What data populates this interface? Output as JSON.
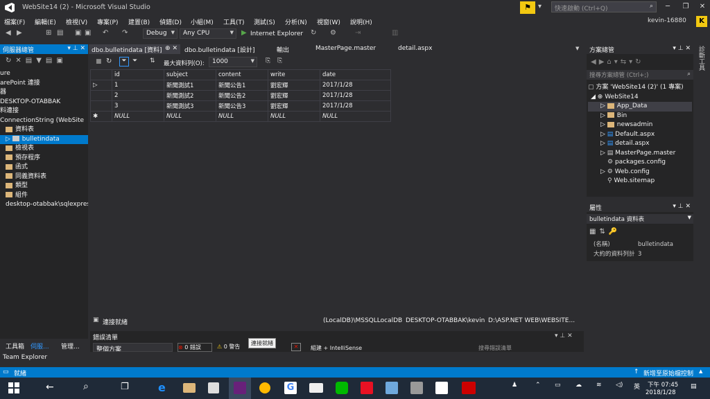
{
  "window": {
    "title": "WebSite14 (2) - Microsoft Visual Studio",
    "quick_launch": "快速啟動 (Ctrl+Q)",
    "user": "kevin-16880",
    "user_badge": "K"
  },
  "menu": [
    "檔案(F)",
    "編輯(E)",
    "檢視(V)",
    "專案(P)",
    "建置(B)",
    "偵錯(D)",
    "小組(M)",
    "工具(T)",
    "測試(S)",
    "分析(N)",
    "視窗(W)",
    "說明(H)"
  ],
  "toolbar": {
    "config": "Debug",
    "platform": "Any CPU",
    "run": "Internet Explorer"
  },
  "server_explorer": {
    "title": "伺服器總管",
    "items": [
      "ure",
      "arePoint 連接",
      "器",
      "DESKTOP-OTABBAK",
      "料連接",
      "ConnectionString (WebSite",
      "資料表",
      "bulletindata",
      "檢視表",
      "預存程序",
      "函式",
      "同義資料表",
      "類型",
      "組件",
      "desktop-otabbak\\sqlexpres"
    ],
    "bottom_tabs": [
      "工具箱",
      "伺服...",
      "管理..."
    ],
    "team": "Team Explorer"
  },
  "tabs": [
    "dbo.bulletindata [資料]",
    "dbo.bulletindata [設計]",
    "輸出",
    "MasterPage.master",
    "detail.aspx"
  ],
  "grid_toolbar": {
    "max_rows_label": "最大資料列(O):",
    "max_rows": "1000"
  },
  "grid": {
    "columns": [
      "id",
      "subject",
      "content",
      "write",
      "date"
    ],
    "rows": [
      [
        "1",
        "新聞測試1",
        "新聞公告1",
        "劉宏輝",
        "2017/1/28"
      ],
      [
        "2",
        "新聞測試2",
        "新聞公告2",
        "劉宏輝",
        "2017/1/28"
      ],
      [
        "3",
        "新聞測試3",
        "新聞公告3",
        "劉宏輝",
        "2017/1/28"
      ],
      [
        "NULL",
        "NULL",
        "NULL",
        "NULL",
        "NULL"
      ]
    ]
  },
  "conn_status": {
    "text": "連接就緒",
    "db": "(LocalDB)\\MSSQLLocalDB",
    "server": "DESKTOP-OTABBAK\\kevin",
    "path": "D:\\ASP.NET WEB\\WEBSITE..."
  },
  "error_list": {
    "title": "錯誤清單",
    "scope": "整個方案",
    "errors": "0 錯誤",
    "warnings": "0 警告",
    "tooltip": "連接就緒",
    "build": "組建 + IntelliSense",
    "search": "搜尋錯誤清單"
  },
  "solution": {
    "title": "方案總管",
    "search": "搜尋方案總管 (Ctrl+;)",
    "root": "方案 'WebSite14 (2)' (1 專案)",
    "project": "WebSite14",
    "items": [
      "App_Data",
      "Bin",
      "newsadmin",
      "Default.aspx",
      "detail.aspx",
      "MasterPage.master",
      "packages.config",
      "Web.config",
      "Web.sitemap"
    ]
  },
  "properties": {
    "title": "屬性",
    "object": "bulletindata  資料表",
    "rows": [
      [
        "(名稱)",
        "bulletindata"
      ],
      [
        "大約的資料列計",
        "3"
      ]
    ]
  },
  "side_label": "診斷工具",
  "statusbar": {
    "left": "就緒",
    "right": "新增至原始檔控制"
  },
  "taskbar": {
    "time": "下午 07:45",
    "date": "2018/1/28",
    "ime": "英"
  }
}
